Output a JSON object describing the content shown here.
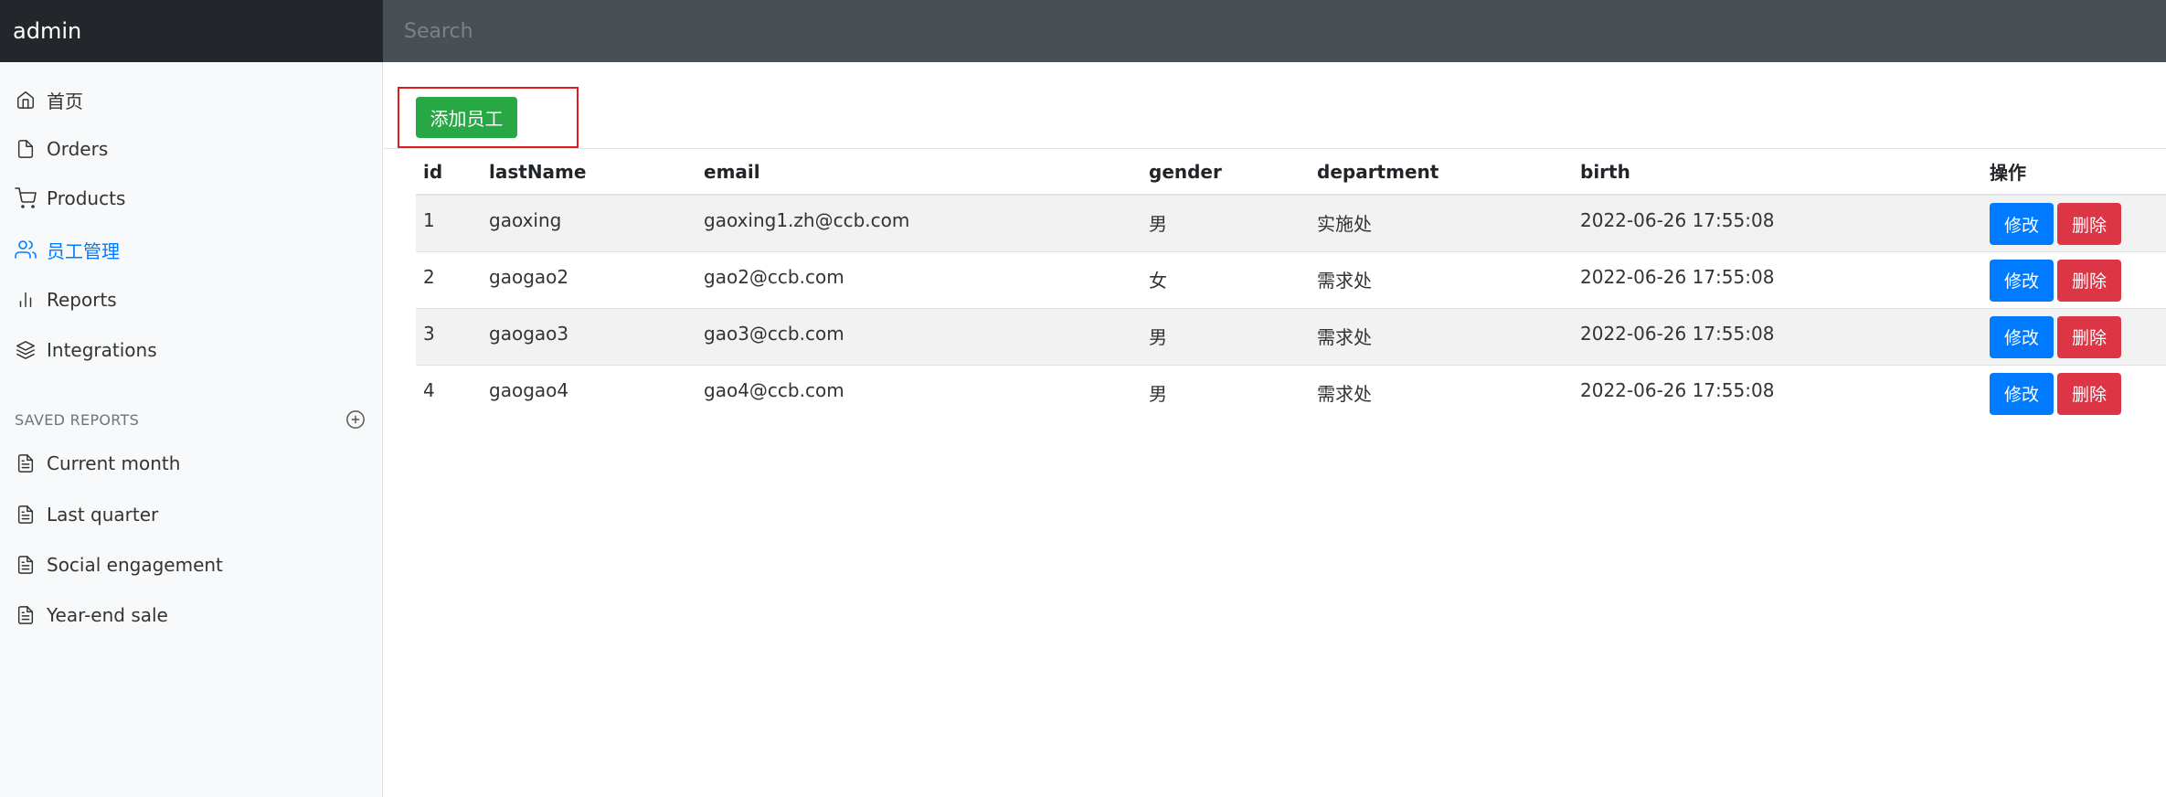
{
  "navbar": {
    "brand": "admin",
    "search_placeholder": "Search"
  },
  "sidebar": {
    "items": [
      {
        "label": "首页",
        "icon": "home-icon",
        "active": false
      },
      {
        "label": "Orders",
        "icon": "file-icon",
        "active": false
      },
      {
        "label": "Products",
        "icon": "shopping-cart-icon",
        "active": false
      },
      {
        "label": "员工管理",
        "icon": "users-icon",
        "active": true
      },
      {
        "label": "Reports",
        "icon": "bar-chart-icon",
        "active": false
      },
      {
        "label": "Integrations",
        "icon": "layers-icon",
        "active": false
      }
    ],
    "saved_heading": "SAVED REPORTS",
    "saved_items": [
      {
        "label": "Current month",
        "icon": "file-text-icon"
      },
      {
        "label": "Last quarter",
        "icon": "file-text-icon"
      },
      {
        "label": "Social engagement",
        "icon": "file-text-icon"
      },
      {
        "label": "Year-end sale",
        "icon": "file-text-icon"
      }
    ]
  },
  "main": {
    "add_button": "添加员工",
    "table": {
      "headers": [
        "id",
        "lastName",
        "email",
        "gender",
        "department",
        "birth",
        "操作"
      ],
      "rows": [
        [
          "1",
          "gaoxing",
          "gaoxing1.zh@ccb.com",
          "男",
          "实施处",
          "2022-06-26 17:55:08"
        ],
        [
          "2",
          "gaogao2",
          "gao2@ccb.com",
          "女",
          "需求处",
          "2022-06-26 17:55:08"
        ],
        [
          "3",
          "gaogao3",
          "gao3@ccb.com",
          "男",
          "需求处",
          "2022-06-26 17:55:08"
        ],
        [
          "4",
          "gaogao4",
          "gao4@ccb.com",
          "男",
          "需求处",
          "2022-06-26 17:55:08"
        ]
      ],
      "edit_label": "修改",
      "delete_label": "删除"
    }
  },
  "colors": {
    "accent": "#007bff",
    "success": "#28a745",
    "danger": "#dc3545",
    "navbar": "#343a40"
  }
}
